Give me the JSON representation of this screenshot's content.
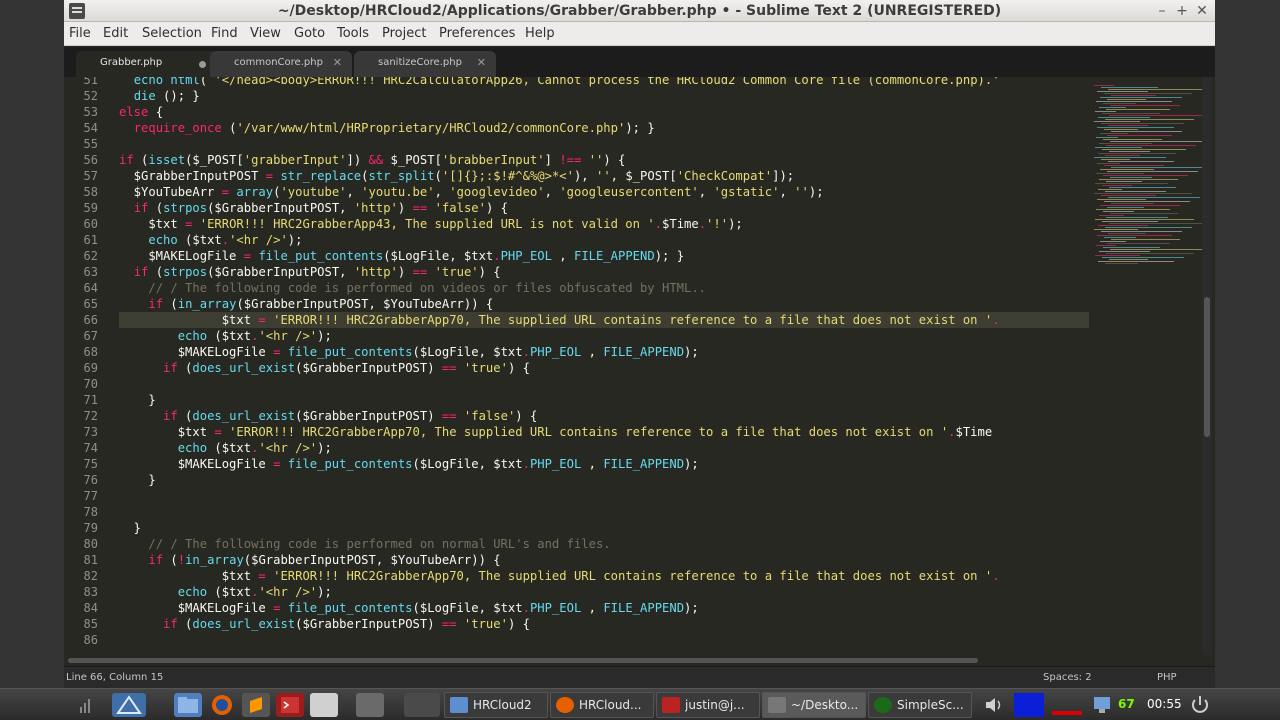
{
  "window": {
    "title": "~/Desktop/HRCloud2/Applications/Grabber/Grabber.php • - Sublime Text 2 (UNREGISTERED)"
  },
  "menu": [
    "File",
    "Edit",
    "Selection",
    "Find",
    "View",
    "Goto",
    "Tools",
    "Project",
    "Preferences",
    "Help"
  ],
  "tabs": [
    {
      "label": "Grabber.php",
      "active": true,
      "dirty": true
    },
    {
      "label": "commonCore.php",
      "active": false
    },
    {
      "label": "sanitizeCore.php",
      "active": false
    }
  ],
  "gutter": [
    "51",
    "52",
    "53",
    "54",
    "55",
    "56",
    "57",
    "58",
    "59",
    "60",
    "61",
    "62",
    "63",
    "64",
    "65",
    "66",
    "67",
    "68",
    "69",
    "70",
    "71",
    "72",
    "73",
    "74",
    "75",
    "76",
    "77",
    "78",
    "79",
    "80",
    "81",
    "82",
    "83",
    "84",
    "85",
    "86"
  ],
  "status": {
    "position": "Line 66, Column 15",
    "spaces": "Spaces: 2",
    "syntax": "PHP"
  },
  "taskbar": {
    "tasks": [
      "HRCloud2",
      "HRCloud...",
      "justin@j...",
      "~/Deskto...",
      "SimpleSc..."
    ],
    "battery": "67",
    "clock": "00:55"
  },
  "colors": {
    "keyword": "#f92672",
    "function": "#66d9ef",
    "string": "#e6db74",
    "comment": "#75715e",
    "constant": "#ae81ff",
    "background": "#272822"
  }
}
